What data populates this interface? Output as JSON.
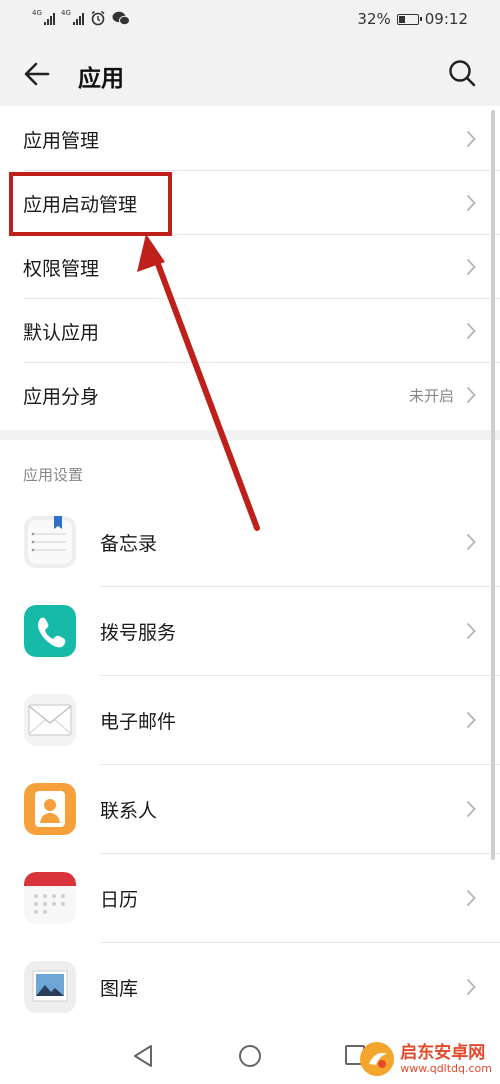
{
  "status": {
    "network1": "4G",
    "network2": "4G",
    "battery_pct": "32%",
    "battery_level": 0.32,
    "time": "09:12"
  },
  "header": {
    "title": "应用",
    "back_icon": "arrow-left-icon",
    "search_icon": "search-icon"
  },
  "menu": [
    {
      "label": "应用管理",
      "value": ""
    },
    {
      "label": "应用启动管理",
      "value": ""
    },
    {
      "label": "权限管理",
      "value": ""
    },
    {
      "label": "默认应用",
      "value": ""
    },
    {
      "label": "应用分身",
      "value": "未开启"
    }
  ],
  "section": {
    "title": "应用设置"
  },
  "apps": [
    {
      "label": "备忘录",
      "icon": "notepad-icon"
    },
    {
      "label": "拨号服务",
      "icon": "phone-icon"
    },
    {
      "label": "电子邮件",
      "icon": "mail-icon"
    },
    {
      "label": "联系人",
      "icon": "contacts-icon"
    },
    {
      "label": "日历",
      "icon": "calendar-icon"
    },
    {
      "label": "图库",
      "icon": "gallery-icon"
    }
  ],
  "watermark": {
    "name": "启东安卓网",
    "url": "www.qdltdq.com"
  },
  "colors": {
    "accent_red": "#c0201b",
    "background_gray": "#f2f2f2",
    "phone_teal": "#17b9a8",
    "contacts_orange": "#f5a03a",
    "calendar_red": "#d9333b"
  }
}
